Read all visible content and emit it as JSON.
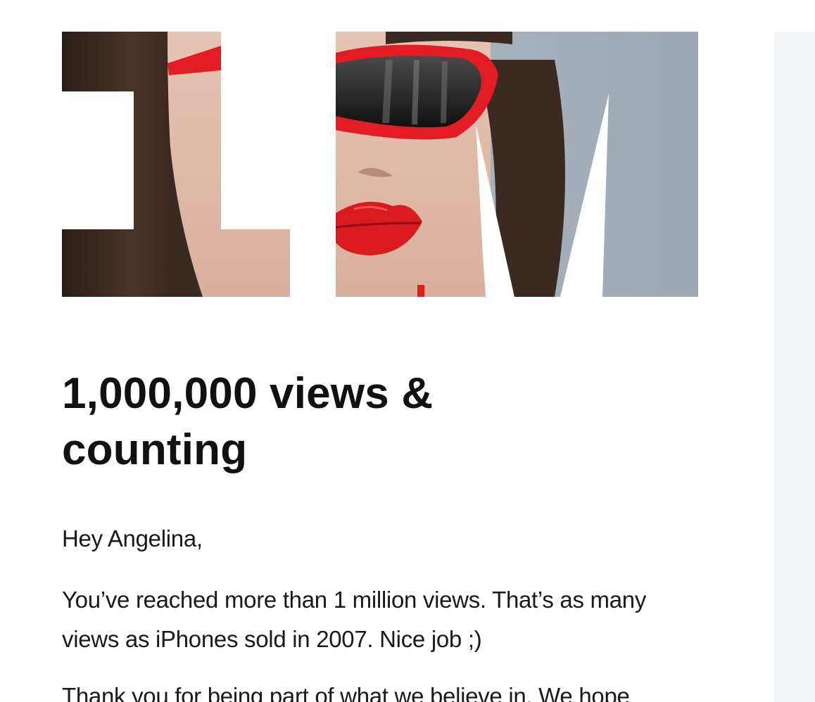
{
  "email": {
    "hero": {
      "text": "1M",
      "photo_subject": "woman-with-red-sunglasses-and-red-lipstick"
    },
    "headline": "1,000,000 views & counting",
    "greeting": "Hey Angelina,",
    "paragraphs": [
      "You’ve reached more than 1 million views. That’s as many views as iPhones sold in 2007. Nice job ;)",
      "Thank you for being part of what we believe in. We hope"
    ]
  },
  "colors": {
    "background": "#ffffff",
    "side_panel": "#f4f5f7",
    "headline_text": "#111111",
    "body_text": "#1a1a1a",
    "accent_red": "#e31b23",
    "hair": "#3a2a22",
    "wall_blue_gray": "#a9b4bf"
  }
}
